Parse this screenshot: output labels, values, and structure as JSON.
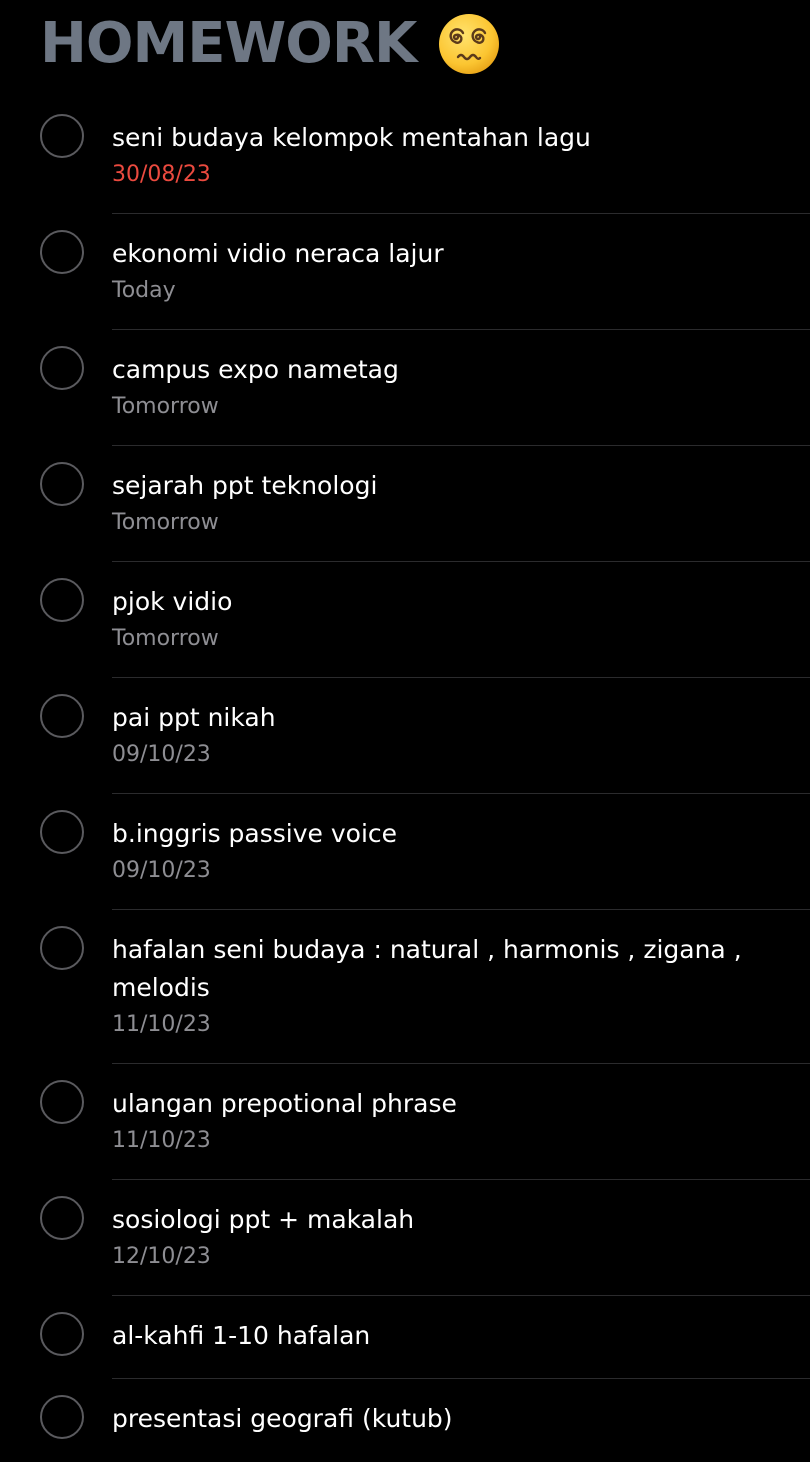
{
  "list": {
    "title": "HOMEWORK",
    "title_emoji_icon": "dizzy-face-emoji",
    "title_color": "#6e7784"
  },
  "colors": {
    "background": "#000000",
    "overdue_date": "#eb4a3f",
    "date": "#8e8e93",
    "separator": "#2b2b2d",
    "checkbox_border": "#5a5a5e"
  },
  "reminders": [
    {
      "title": "seni budaya kelompok mentahan lagu",
      "date": "30/08/23",
      "overdue": true
    },
    {
      "title": "ekonomi vidio neraca lajur",
      "date": "Today",
      "overdue": false
    },
    {
      "title": "campus expo nametag",
      "date": "Tomorrow",
      "overdue": false
    },
    {
      "title": "sejarah ppt teknologi",
      "date": "Tomorrow",
      "overdue": false
    },
    {
      "title": "pjok vidio",
      "date": "Tomorrow",
      "overdue": false
    },
    {
      "title": "pai ppt nikah",
      "date": "09/10/23",
      "overdue": false
    },
    {
      "title": "b.inggris passive voice",
      "date": "09/10/23",
      "overdue": false
    },
    {
      "title": "hafalan seni budaya : natural , harmonis , zigana , melodis",
      "date": "11/10/23",
      "overdue": false
    },
    {
      "title": "ulangan prepotional phrase",
      "date": "11/10/23",
      "overdue": false
    },
    {
      "title": "sosiologi ppt + makalah",
      "date": "12/10/23",
      "overdue": false
    },
    {
      "title": "al-kahfi 1-10 hafalan",
      "date": null,
      "overdue": false
    },
    {
      "title": "presentasi geografi (kutub)",
      "date": null,
      "overdue": false
    }
  ]
}
